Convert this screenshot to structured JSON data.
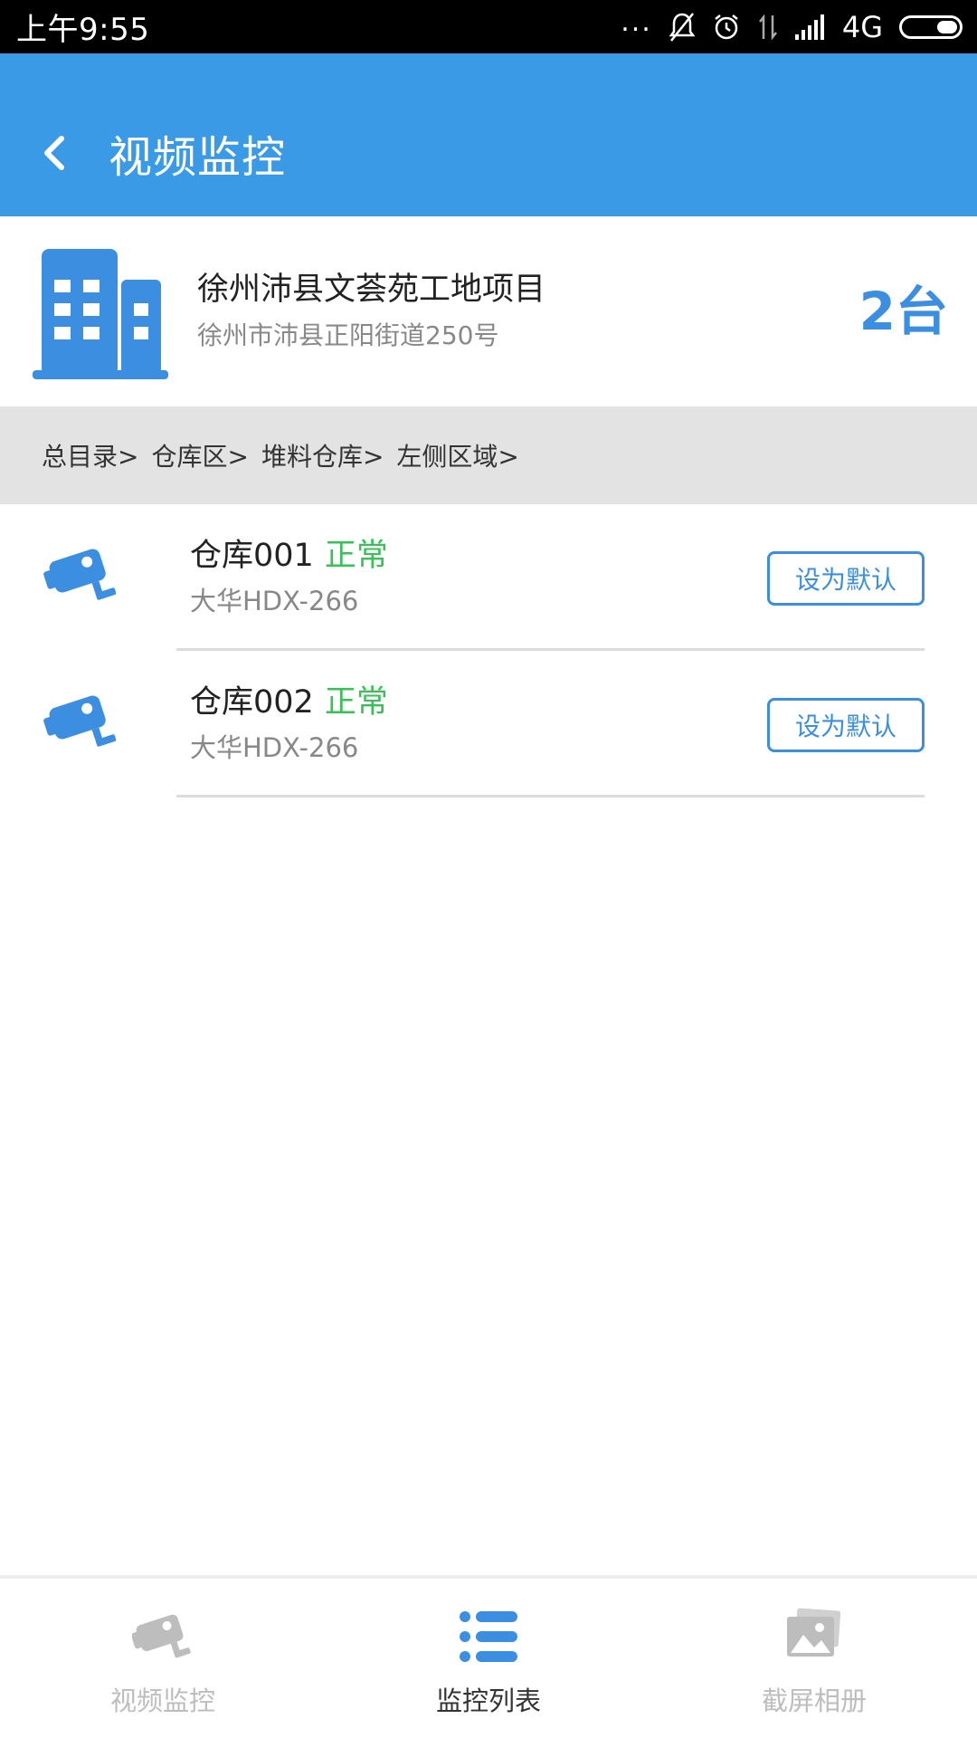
{
  "status_bar": {
    "time": "上午9:55",
    "network": "4G",
    "dots": "..."
  },
  "app_bar": {
    "title": "视频监控"
  },
  "project": {
    "name": "徐州沛县文荟苑工地项目",
    "address": "徐州市沛县正阳街道250号",
    "count": "2台",
    "icon": "building-icon"
  },
  "breadcrumb": {
    "items": [
      "总目录>",
      "仓库区>",
      "堆料仓库>",
      "左侧区域>"
    ]
  },
  "devices": [
    {
      "name": "仓库001",
      "status": "正常",
      "model": "大华HDX-266",
      "button_label": "设为默认"
    },
    {
      "name": "仓库002",
      "status": "正常",
      "model": "大华HDX-266",
      "button_label": "设为默认"
    }
  ],
  "bottom_nav": {
    "items": [
      {
        "label": "视频监控",
        "icon": "camera-icon",
        "active": false
      },
      {
        "label": "监控列表",
        "icon": "list-icon",
        "active": true
      },
      {
        "label": "截屏相册",
        "icon": "gallery-icon",
        "active": false
      }
    ]
  },
  "colors": {
    "primary": "#3b9ae6",
    "accent_text": "#3b8ee0",
    "status_ok": "#3cbe5a",
    "breadcrumb_bg": "#e3e3e3"
  }
}
